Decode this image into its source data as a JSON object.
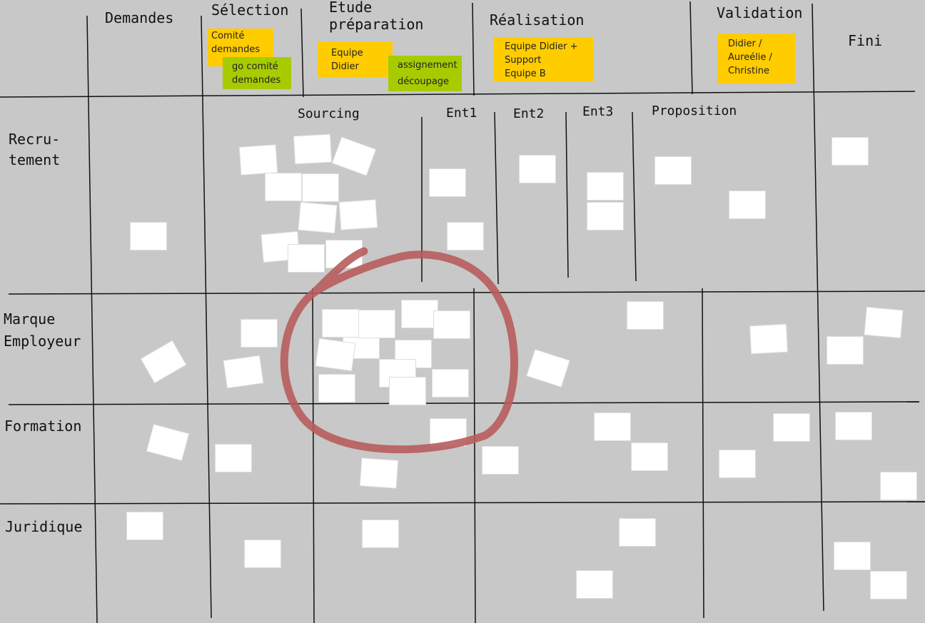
{
  "columns": {
    "demandes": "Demandes",
    "selection": "Sélection",
    "etude": "Etude\npréparation",
    "realisation": "Réalisation",
    "validation": "Validation",
    "fini": "Fini"
  },
  "sub_columns": {
    "sourcing": "Sourcing",
    "ent1": "Ent1",
    "ent2": "Ent2",
    "ent3": "Ent3",
    "proposition": "Proposition"
  },
  "rows": {
    "recrutement": "Recru-\ntement",
    "marque": "Marque\nEmployeur",
    "formation": "Formation",
    "juridique": "Juridique"
  },
  "tags": {
    "comite": "Comité\ndemandes",
    "go_comite": "go comité\ndemandes",
    "equipe_didier": "Equipe\nDidier",
    "assignement": "assignement\ndécoupage",
    "realisation_team": "Equipe Didier +\nSupport\nEquipe B",
    "validation_team": "Didier /\nAureélie /\nChristine"
  },
  "colors": {
    "orange": "#ffcc00",
    "green": "#a6cc00",
    "highlight": "#b85c5c"
  }
}
